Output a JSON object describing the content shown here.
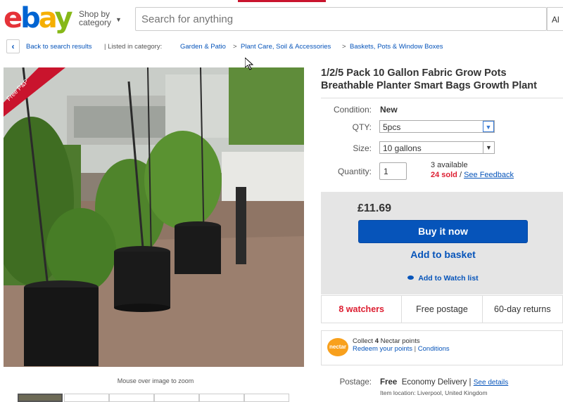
{
  "header": {
    "logo_letters": [
      "e",
      "b",
      "a",
      "y"
    ],
    "shop_by": [
      "Shop by",
      "category"
    ],
    "search_placeholder": "Search for anything",
    "category_select": "Al"
  },
  "breadcrumb": {
    "back": "Back to search results",
    "listed_in": "| Listed in category:",
    "items": [
      "Garden & Patio",
      "Plant Care, Soil & Accessories",
      "Baskets, Pots & Window Boxes"
    ],
    "separator": ">"
  },
  "image": {
    "ribbon": "Free P&P",
    "zoom_hint": "Mouse over image to zoom"
  },
  "listing": {
    "title": "1/2/5 Pack 10 Gallon Fabric Grow Pots Breathable Planter Smart Bags Growth Plant",
    "condition_label": "Condition:",
    "condition_value": "New",
    "qty_label": "QTY:",
    "qty_value": "5pcs",
    "size_label": "Size:",
    "size_value": "10 gallons",
    "quantity_label": "Quantity:",
    "quantity_value": "1",
    "available": "3 available",
    "sold": "24 sold",
    "sold_sep": " / ",
    "feedback": "See Feedback"
  },
  "buy": {
    "price": "£11.69",
    "buy_now": "Buy it now",
    "add_basket": "Add to basket",
    "watch": "Add to Watch list"
  },
  "stats": {
    "watchers": "8 watchers",
    "postage": "Free postage",
    "returns": "60-day returns"
  },
  "nectar": {
    "logo": "nectar",
    "collect_pre": "Collect ",
    "points": "4",
    "collect_post": " Nectar points",
    "redeem": "Redeem your points",
    "sep": " | ",
    "conditions": "Conditions"
  },
  "postage": {
    "label": "Postage:",
    "free": "Free",
    "service": "Economy Delivery",
    "sep": " | ",
    "details": "See details",
    "location": "Item location:  Liverpool, United Kingdom"
  },
  "colors": {
    "ebay_red": "#e53238",
    "ebay_blue": "#0064d2",
    "ebay_yellow": "#f5af02",
    "ebay_green": "#86b817",
    "link": "#0654ba",
    "button": "#0654ba",
    "alert_red": "#dd1e31",
    "ribbon": "#c9142d"
  }
}
